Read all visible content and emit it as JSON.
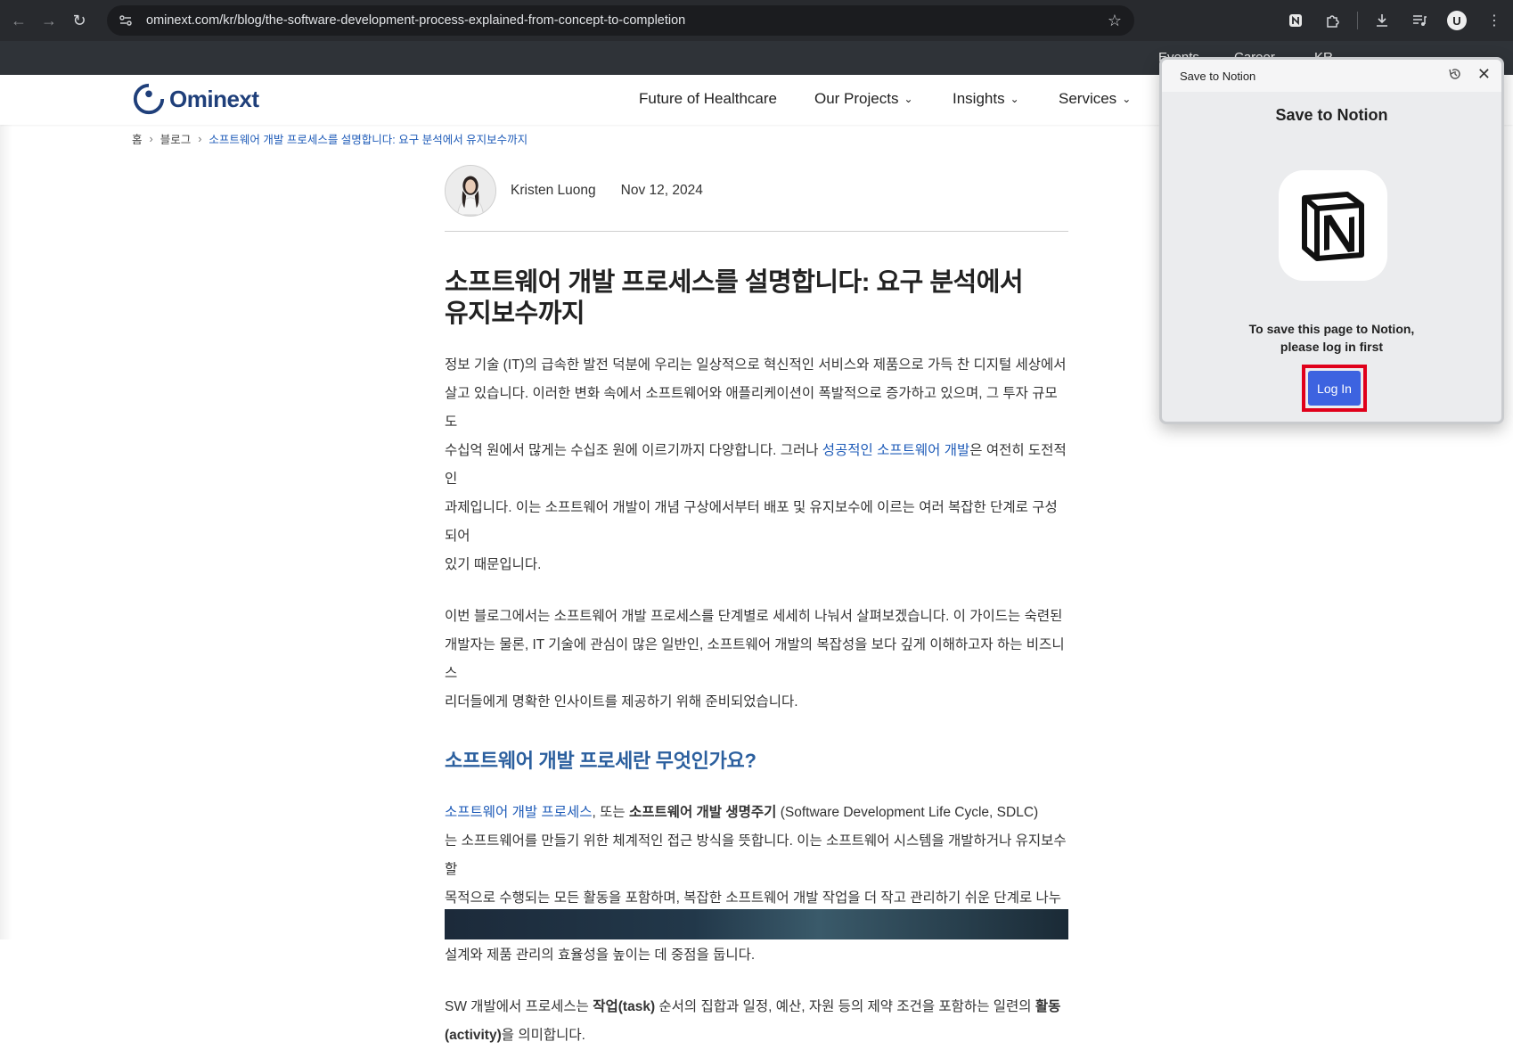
{
  "browser": {
    "url": "ominext.com/kr/blog/the-software-development-process-explained-from-concept-to-completion",
    "profile_initial": "U"
  },
  "topbar": {
    "links": [
      "Events",
      "Career",
      "KR"
    ]
  },
  "site": {
    "logo_text": "Ominext",
    "brand_color": "#1f3f7a",
    "menu": [
      "Future of Healthcare",
      "Our Projects",
      "Insights",
      "Services"
    ]
  },
  "breadcrumb": {
    "home": "홈",
    "blog": "블로그",
    "current": "소프트웨어 개발 프로세스를 설명합니다: 요구 분석에서 유지보수까지"
  },
  "article": {
    "author": "Kristen Luong",
    "date": "Nov 12, 2024",
    "title_line1": "소프트웨어 개발 프로세스를 설명합니다: 요구 분석에서",
    "title_line2": "유지보수까지",
    "p1_a": "정보 기술 (IT)의 급속한 발전 덕분에 우리는 일상적으로 혁신적인 서비스와 제품으로 가득 찬 디지털 세상에서",
    "p1_b": "살고 있습니다. 이러한 변화 속에서 소프트웨어와 애플리케이션이 폭발적으로 증가하고 있으며, 그 투자 규모도",
    "p1_c_pre": "수십억 원에서 많게는 수십조 원에 이르기까지 다양합니다. 그러나 ",
    "p1_c_link": "성공적인 소프트웨어 개발",
    "p1_c_post": "은 여전히 도전적인",
    "p1_d": "과제입니다. 이는 소프트웨어 개발이 개념 구상에서부터 배포 및 유지보수에 이르는 여러 복잡한 단계로 구성되어",
    "p1_e": "있기 때문입니다.",
    "p2_a": "이번 블로그에서는 소프트웨어 개발 프로세스를 단계별로 세세히 나눠서 살펴보겠습니다. 이 가이드는 숙련된",
    "p2_b": "개발자는 물론, IT 기술에 관심이 많은 일반인, 소프트웨어 개발의 복잡성을 보다 깊게 이해하고자 하는 비즈니스",
    "p2_c": "리더들에게 명확한 인사이트를 제공하기 위해 준비되었습니다.",
    "h2": "소프트웨어 개발 프로세란 무엇인가요?",
    "p3_link": "소프트웨어 개발 프로세스",
    "p3_mid": ", 또는 ",
    "p3_bold": "소프트웨어 개발 생명주기",
    "p3_tail": " (Software Development Life Cycle, SDLC)",
    "p3_b": "는 소프트웨어를 만들기 위한 체계적인 접근 방식을 뜻합니다. 이는 소프트웨어 시스템을 개발하거나 유지보수할",
    "p3_c": "목적으로 수행되는 모든 활동을 포함하며, 복잡한 소프트웨어 개발 작업을 더 작고 관리하기 쉬운 단계로 나누어",
    "p3_d": "설계와 제품 관리의 효율성을 높이는 데 중점을 둡니다.",
    "p4_pre": "SW 개발에서 프로세스는 ",
    "p4_bold1": "작업(task)",
    "p4_mid": " 순서의 집합과 일정, 예산, 자원 등의 제약 조건을 포함하는 일련의 ",
    "p4_bold2": "활동",
    "p4_bold3": "(activity)",
    "p4_end": "을 의미합니다."
  },
  "notion_popup": {
    "header_title": "Save to Notion",
    "title": "Save to Notion",
    "message_line1": "To save this page to Notion,",
    "message_line2": "please log in first",
    "login_label": "Log In",
    "button_color": "#3d63e0",
    "highlight_color": "#e0001a"
  }
}
